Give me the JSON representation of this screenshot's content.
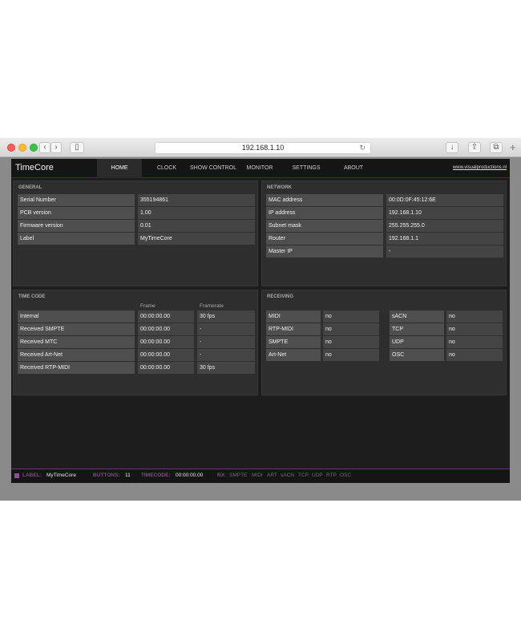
{
  "browser": {
    "url": "192.168.1.10",
    "back_icon": "‹",
    "forward_icon": "›",
    "sidebar_icon": "▯",
    "reload_icon": "↻",
    "download_icon": "↓",
    "share_icon": "⇧",
    "tabs_icon": "⧉",
    "plus_icon": "+"
  },
  "app": {
    "brand": "TimeCore",
    "nav": [
      "HOME",
      "CLOCK",
      "SHOW CONTROL",
      "MONITOR",
      "SETTINGS",
      "ABOUT"
    ],
    "active_tab": "HOME",
    "website": "www.visualproductions.nl"
  },
  "general": {
    "title": "GENERAL",
    "rows": [
      {
        "label": "Serial Number",
        "value": "355194861"
      },
      {
        "label": "PCB version",
        "value": "1.00"
      },
      {
        "label": "Firmware version",
        "value": "0.01"
      },
      {
        "label": "Label",
        "value": "MyTimeCore"
      }
    ]
  },
  "network": {
    "title": "NETWORK",
    "rows": [
      {
        "label": "MAC address",
        "value": "00:0D:0F:45:12:6E"
      },
      {
        "label": "IP address",
        "value": "192.168.1.10"
      },
      {
        "label": "Subnet mask",
        "value": "255.255.255.0"
      },
      {
        "label": "Router",
        "value": "192.168.1.1"
      },
      {
        "label": "Master IP",
        "value": "-"
      }
    ]
  },
  "timecode": {
    "title": "TIME CODE",
    "col_frame": "Frame",
    "col_framerate": "Framerate",
    "rows": [
      {
        "label": "Internal",
        "frame": "00:00:00.00",
        "rate": "30 fps"
      },
      {
        "label": "Received SMPTE",
        "frame": "00:00:00.00",
        "rate": "-"
      },
      {
        "label": "Received MTC",
        "frame": "00:00:00.00",
        "rate": "-"
      },
      {
        "label": "Received Art-Net",
        "frame": "00:00:00.00",
        "rate": "-"
      },
      {
        "label": "Received RTP-MIDI",
        "frame": "00:00:00.00",
        "rate": "30 fps"
      }
    ]
  },
  "receiving": {
    "title": "RECEIVING",
    "left": [
      {
        "label": "MIDI",
        "value": "no"
      },
      {
        "label": "RTP-MIDI",
        "value": "no"
      },
      {
        "label": "SMPTE",
        "value": "no"
      },
      {
        "label": "Art-Net",
        "value": "no"
      }
    ],
    "right": [
      {
        "label": "sACN",
        "value": "no"
      },
      {
        "label": "TCP",
        "value": "no"
      },
      {
        "label": "UDP",
        "value": "no"
      },
      {
        "label": "OSC",
        "value": "no"
      }
    ]
  },
  "footer": {
    "label_key": "LABEL:",
    "label_value": "MyTimeCore",
    "buttons_key": "BUTTONS:",
    "buttons_value": "11",
    "timecode_key": "TIMECODE:",
    "timecode_value": "00:00:00.00",
    "rx_key": "RX:",
    "rx_items": [
      "SMPTE",
      "MIDI",
      "ART",
      "sACN",
      "TCP",
      "UDP",
      "RTP",
      "OSC"
    ]
  },
  "colors": {
    "accent": "#8d4f98",
    "background": "#1d1d1d",
    "panel": "#2e2e2e"
  }
}
